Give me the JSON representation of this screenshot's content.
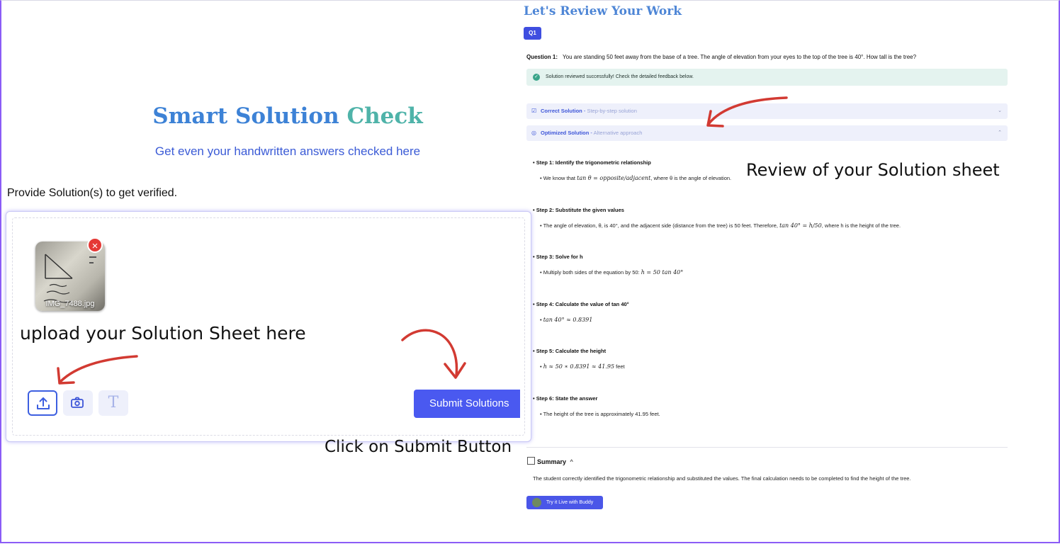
{
  "left": {
    "title_part1": "Smart Solution",
    "title_part2": "Check",
    "subtitle": "Get even your handwritten answers checked here",
    "provide_label": "Provide Solution(s) to get verified.",
    "file_name": "IMG_7488.jpg",
    "remove_icon": "×",
    "upload_caption": "upload your Solution Sheet here",
    "tools": [
      "upload-icon",
      "camera-icon",
      "text-icon"
    ],
    "text_tool_glyph": "T",
    "submit_label": "Submit Solutions",
    "click_caption": "Click on Submit Button"
  },
  "right": {
    "title": "Let's Review Your Work",
    "question_badge": "Q1",
    "question_label": "Question 1:",
    "question_text": "You are standing 50 feet away from the base of a tree. The angle of elevation from your eyes to the top of the tree is 40°. How tall is the tree?",
    "success_text": "Solution reviewed successfully! Check the detailed feedback below.",
    "accordions": [
      {
        "title": "Correct Solution",
        "sep": " - ",
        "subtitle": "Step-by-step solution",
        "chevron": "⌄"
      },
      {
        "title": "Optimized Solution",
        "sep": " - ",
        "subtitle": "Alternative approach",
        "chevron": "⌃"
      }
    ],
    "review_caption": "Review of your Solution sheet",
    "steps": [
      {
        "title": "Step 1: Identify the trigonometric relationship",
        "pre": "We know that ",
        "math": "tan θ = opposite/adjacent",
        "post": ", where θ is the angle of elevation."
      },
      {
        "title": "Step 2: Substitute the given values",
        "pre": "The angle of elevation, θ, is 40°, and the adjacent side (distance from the tree) is 50 feet.  Therefore, ",
        "math": "tan 40° = h/50",
        "post": ", where h is the height of the tree."
      },
      {
        "title": "Step 3: Solve for h",
        "pre": "Multiply both sides of the equation by 50: ",
        "math": "h = 50 tan 40°",
        "post": ""
      },
      {
        "title": "Step 4: Calculate the value of tan 40°",
        "pre": "",
        "math": "tan 40° ≈ 0.8391",
        "post": ""
      },
      {
        "title": "Step 5: Calculate the height",
        "pre": "",
        "math": "h ≈ 50 ∗ 0.8391 ≈ 41.95",
        "post": " feet"
      },
      {
        "title": "Step 6: State the answer",
        "pre": "The height of the tree is approximately 41.95 feet.",
        "math": "",
        "post": ""
      }
    ],
    "summary_title": "Summary",
    "summary_chevron": "^",
    "summary_text": "The student correctly identified the trigonometric relationship and substituted the values. The final calculation needs to be completed to find the height of the tree.",
    "buddy_button": "Try it Live with Buddy"
  },
  "colors": {
    "accent": "#4a59f0",
    "title_blue": "#3d82d6",
    "title_teal": "#4fb3a9",
    "arrow_red": "#d23a32",
    "frame_purple": "#8b5cf6"
  }
}
